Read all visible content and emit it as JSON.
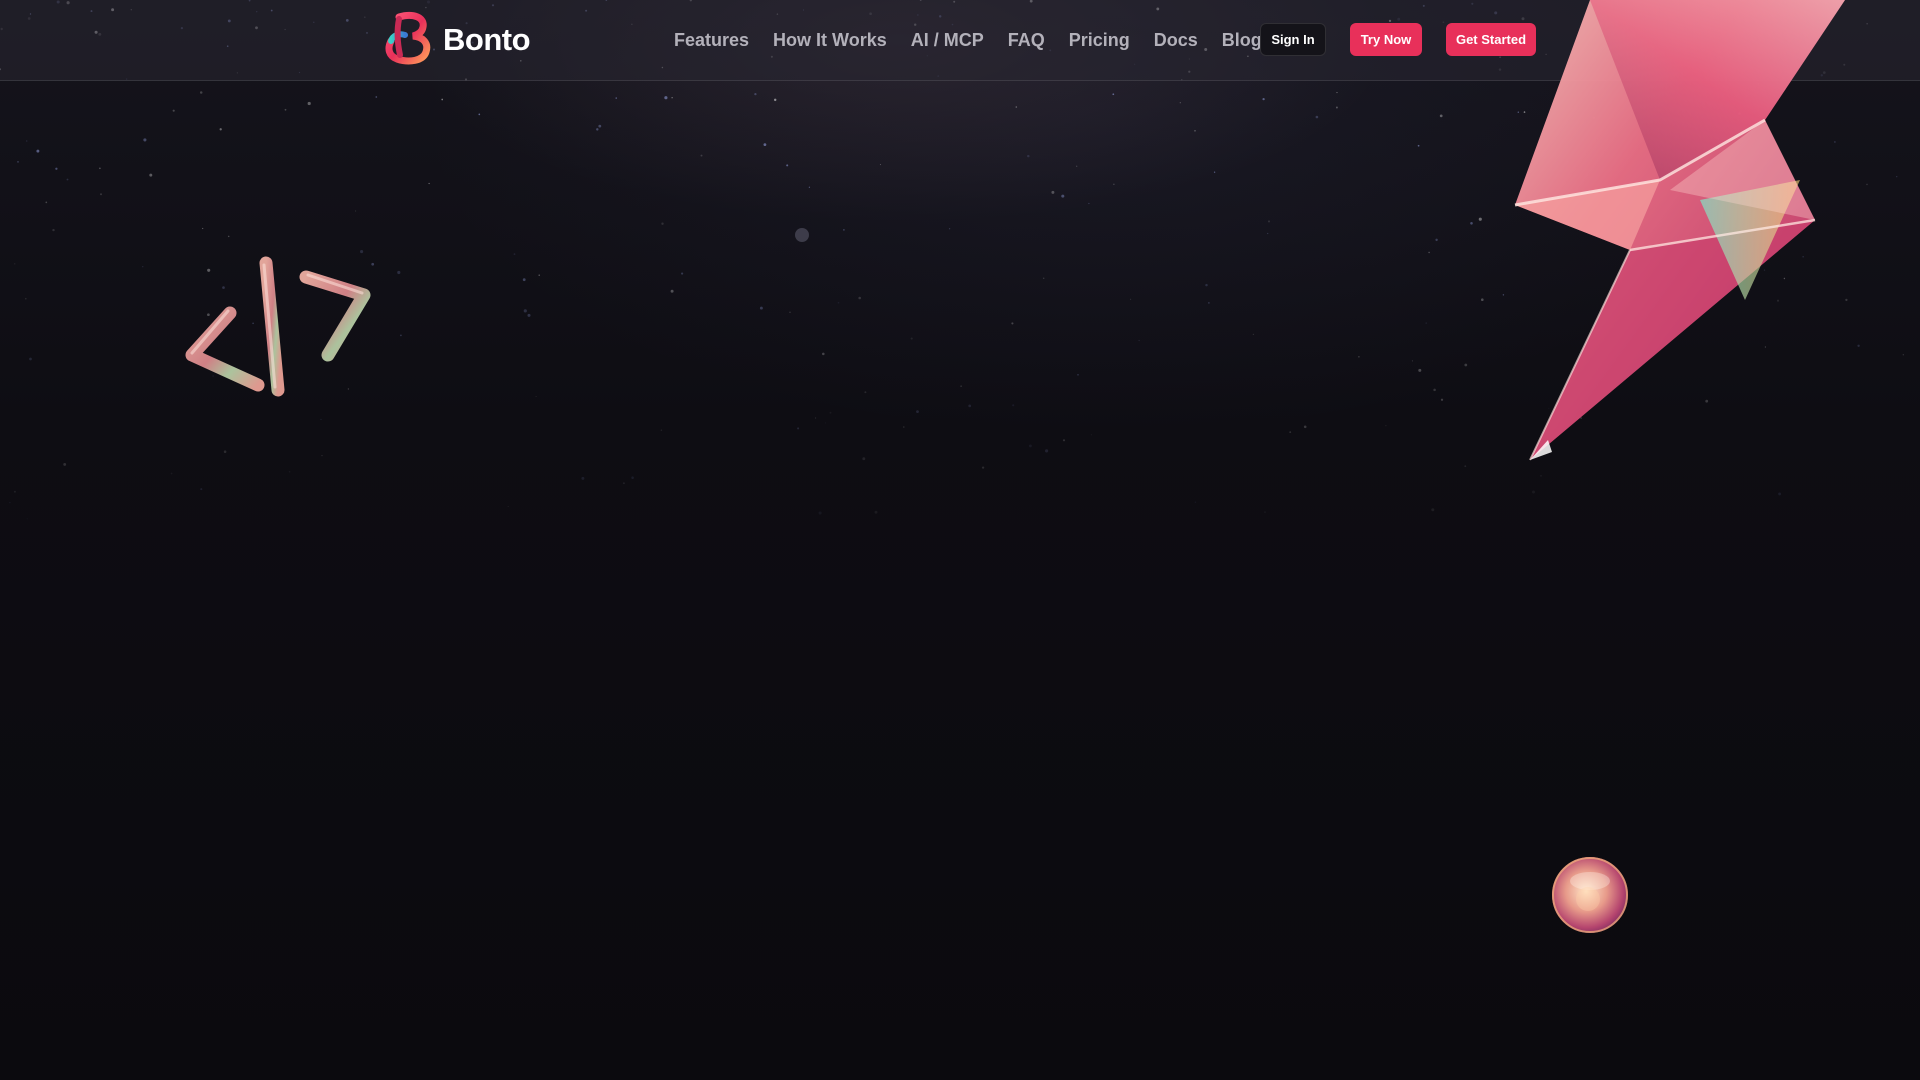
{
  "header": {
    "brand": {
      "name": "Bonto",
      "logo_icon": "bonto-b-logo-icon"
    },
    "nav": [
      {
        "label": "Features"
      },
      {
        "label": "How It Works"
      },
      {
        "label": "AI / MCP"
      },
      {
        "label": "FAQ"
      },
      {
        "label": "Pricing"
      },
      {
        "label": "Docs"
      },
      {
        "label": "Blog"
      }
    ],
    "buttons": {
      "sign_in": "Sign In",
      "try_now": "Try Now",
      "get_started": "Get Started"
    }
  },
  "hero": {
    "decorations": [
      "code-brackets-3d-icon",
      "lightning-bolt-3d-icon",
      "crystal-orb-3d-icon"
    ]
  },
  "colors": {
    "accent": "#e8305a",
    "background": "#0b0a0e",
    "nav_text": "#b3b1ba",
    "header_bg": "#26242f"
  }
}
